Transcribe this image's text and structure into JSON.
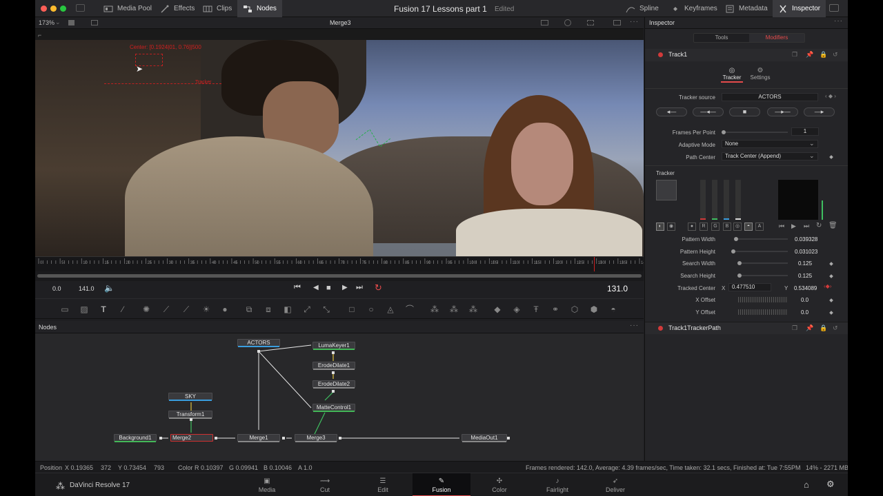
{
  "window": {
    "title": "Fusion 17  Lessons part 1",
    "subtitle": "Edited"
  },
  "topbar": {
    "left": [
      {
        "label": "Media Pool",
        "icon": "media-pool-icon"
      },
      {
        "label": "Effects",
        "icon": "effects-icon"
      },
      {
        "label": "Clips",
        "icon": "clips-icon"
      },
      {
        "label": "Nodes",
        "icon": "nodes-icon"
      }
    ],
    "right": [
      {
        "label": "Spline",
        "icon": "spline-icon"
      },
      {
        "label": "Keyframes",
        "icon": "keyframes-icon"
      },
      {
        "label": "Metadata",
        "icon": "metadata-icon"
      },
      {
        "label": "Inspector",
        "icon": "inspector-icon"
      }
    ]
  },
  "viewer": {
    "zoom": "173%",
    "title": "Merge3",
    "overlay_text": "Center: [0.1924|01, 0.76]|500",
    "overlay_text2": "Tracker"
  },
  "ruler": {
    "ticks": [
      "0",
      "5",
      "10",
      "15",
      "20",
      "25",
      "30",
      "35",
      "40",
      "45",
      "50",
      "55",
      "60",
      "65",
      "70",
      "75",
      "80",
      "85",
      "90",
      "95",
      "100",
      "105",
      "110",
      "115",
      "120",
      "125",
      "130",
      "135",
      "140"
    ]
  },
  "transport": {
    "start": "0.0",
    "end": "141.0",
    "current": "131.0"
  },
  "nodes_panel": {
    "title": "Nodes",
    "nodes": {
      "actors": "ACTORS",
      "lumakeyer": "LumaKeyer1",
      "erode1": "ErodeDilate1",
      "erode2": "ErodeDilate2",
      "mattecontrol": "MatteControl1",
      "sky": "SKY",
      "transform": "Transform1",
      "background": "Background1",
      "merge2": "Merge2",
      "merge1": "Merge1",
      "merge3": "Merge3",
      "mediaout": "MediaOut1"
    }
  },
  "status": {
    "position_label": "Position",
    "x": "X 0.19365",
    "x_px": "372",
    "y": "Y 0.73454",
    "y_px": "793",
    "color_label": "Color",
    "r": "R 0.10397",
    "g": "G 0.09941",
    "b": "B 0.10046",
    "a": "A 1.0",
    "render": "Frames rendered: 142.0,  Average: 4.39 frames/sec,  Time taken: 32.1 secs,  Finished at: Tue 7:55PM",
    "memory": "14% - 2271 MB"
  },
  "app_name": "DaVinci Resolve 17",
  "pages": [
    {
      "label": "Media",
      "icon": "media-page-icon"
    },
    {
      "label": "Cut",
      "icon": "cut-page-icon"
    },
    {
      "label": "Edit",
      "icon": "edit-page-icon"
    },
    {
      "label": "Fusion",
      "icon": "fusion-page-icon"
    },
    {
      "label": "Color",
      "icon": "color-page-icon"
    },
    {
      "label": "Fairlight",
      "icon": "fairlight-page-icon"
    },
    {
      "label": "Deliver",
      "icon": "deliver-page-icon"
    }
  ],
  "inspector": {
    "title": "Inspector",
    "tab_tools": "Tools",
    "tab_modifiers": "Modifiers",
    "node_name": "Track1",
    "subtab_tracker": "Tracker",
    "subtab_settings": "Settings",
    "tracker_source_label": "Tracker source",
    "tracker_source": "ACTORS",
    "frames_per_point_label": "Frames Per Point",
    "frames_per_point": "1",
    "adaptive_mode_label": "Adaptive Mode",
    "adaptive_mode": "None",
    "path_center_label": "Path Center",
    "path_center": "Track Center (Append)",
    "tracker_section": "Tracker",
    "pattern_width_label": "Pattern Width",
    "pattern_width": "0.039328",
    "pattern_height_label": "Pattern Height",
    "pattern_height": "0.031023",
    "search_width_label": "Search Width",
    "search_width": "0.125",
    "search_height_label": "Search Height",
    "search_height": "0.125",
    "tracked_center_label": "Tracked Center",
    "tc_x_label": "X",
    "tc_x": "0.477510",
    "tc_y_label": "Y",
    "tc_y": "0.534089",
    "x_offset_label": "X Offset",
    "x_offset": "0.0",
    "y_offset_label": "Y Offset",
    "y_offset": "0.0",
    "path_node_name": "Track1TrackerPath",
    "channel_buttons": [
      "R",
      "G",
      "B",
      "A"
    ]
  },
  "colors": {
    "accent": "#e64b4b",
    "red": "#d23a3a",
    "active_page_bg": "#0e0e10"
  }
}
